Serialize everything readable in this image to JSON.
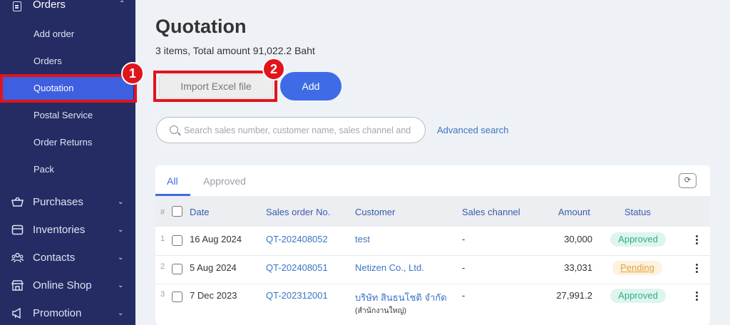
{
  "sidebar": {
    "section": {
      "label": "Orders",
      "chevron": "chevron-up-icon"
    },
    "sub_items": [
      {
        "label": "Add order"
      },
      {
        "label": "Orders"
      },
      {
        "label": "Quotation"
      },
      {
        "label": "Postal Service"
      },
      {
        "label": "Order Returns"
      },
      {
        "label": "Pack"
      }
    ],
    "main_items": [
      {
        "label": "Purchases",
        "icon": "basket-icon"
      },
      {
        "label": "Inventories",
        "icon": "box-icon"
      },
      {
        "label": "Contacts",
        "icon": "people-icon"
      },
      {
        "label": "Online Shop",
        "icon": "shop-icon"
      },
      {
        "label": "Promotion",
        "icon": "megaphone-icon"
      }
    ]
  },
  "annotations": {
    "badge1": "1",
    "badge2": "2",
    "color": "#e1141c"
  },
  "page": {
    "title": "Quotation",
    "subtitle": "3 items, Total amount 91,022.2 Baht"
  },
  "actions": {
    "import_label": "Import Excel file",
    "add_label": "Add"
  },
  "search": {
    "placeholder": "Search sales number, customer name, sales channel and",
    "advanced_label": "Advanced search"
  },
  "tabs": [
    {
      "label": "All",
      "active": true
    },
    {
      "label": "Approved",
      "active": false
    }
  ],
  "table": {
    "columns": {
      "hash": "#",
      "date": "Date",
      "order_no": "Sales order No.",
      "customer": "Customer",
      "channel": "Sales channel",
      "amount": "Amount",
      "status": "Status"
    },
    "rows": [
      {
        "num": "1",
        "date": "16 Aug 2024",
        "order_no": "QT-202408052",
        "customer": "test",
        "customer_sub": "",
        "channel": "-",
        "amount": "30,000",
        "status": "Approved"
      },
      {
        "num": "2",
        "date": "5 Aug 2024",
        "order_no": "QT-202408051",
        "customer": "Netizen Co., Ltd.",
        "customer_sub": "",
        "channel": "-",
        "amount": "33,031",
        "status": "Pending"
      },
      {
        "num": "3",
        "date": "7 Dec 2023",
        "order_no": "QT-202312001",
        "customer": "บริษัท สินธนโชติ จำกัด",
        "customer_sub": "(สำนักงานใหญ่)",
        "channel": "-",
        "amount": "27,991.2",
        "status": "Approved"
      }
    ]
  },
  "colors": {
    "sidebar": "#252c63",
    "accent": "#3f6be6",
    "approved": "#2fae86",
    "pending": "#e0a43c"
  }
}
